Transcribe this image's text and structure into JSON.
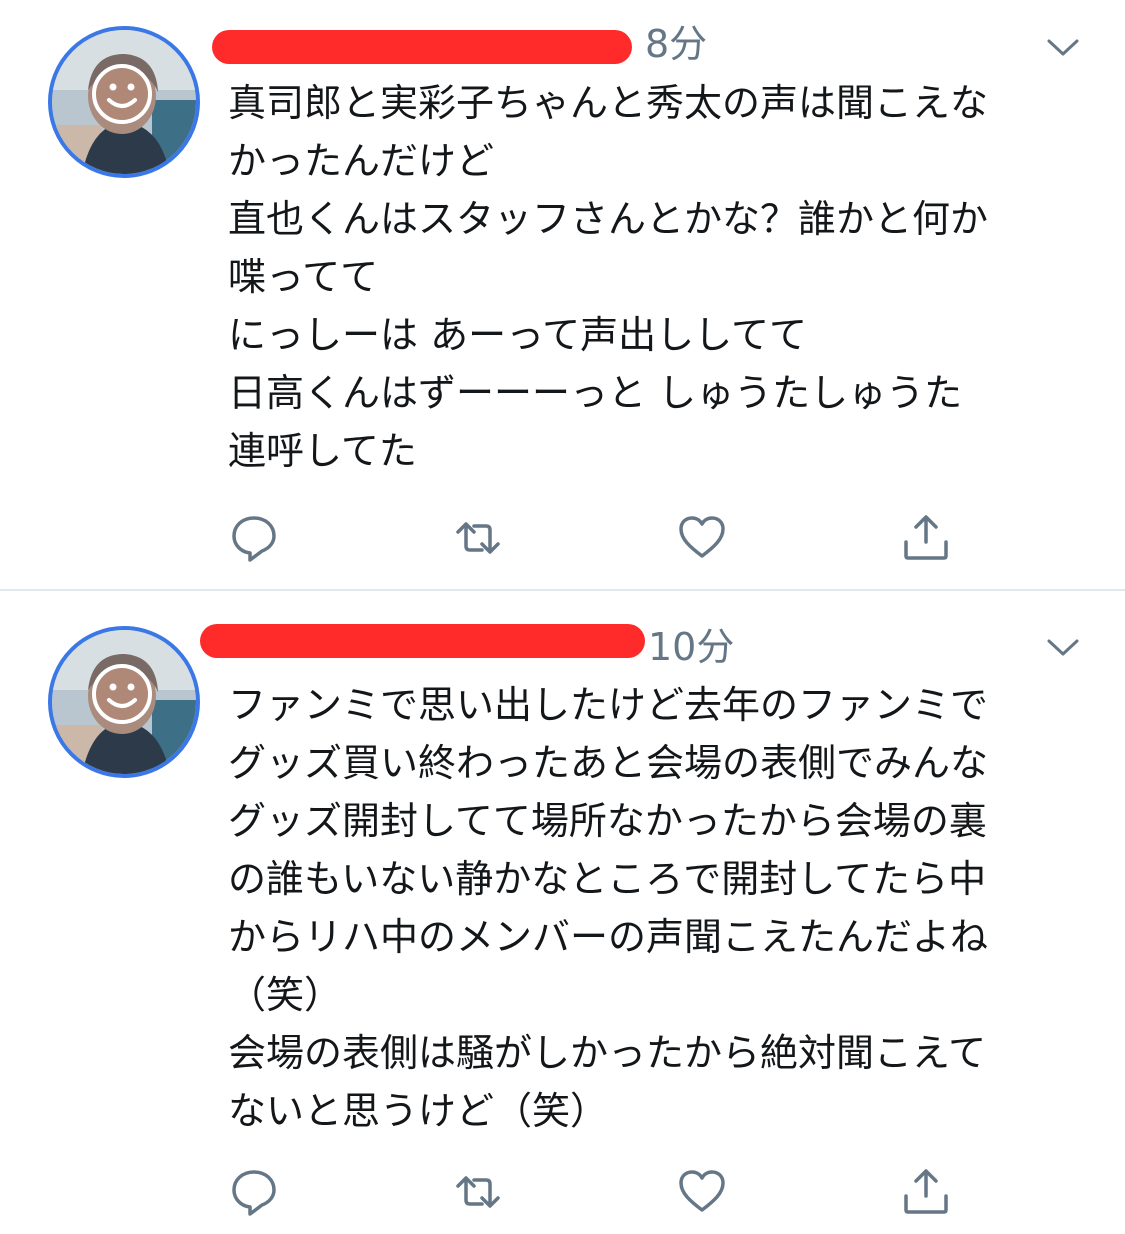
{
  "timeline": {
    "tweets": [
      {
        "time": "8分",
        "lines": [
          "真司郎と実彩子ちゃんと秀太の声は聞こえな",
          "かったんだけど",
          "直也くんはスタッフさんとかな？誰かと何か",
          "喋ってて",
          "にっしーは あーって声出ししてて",
          "日高くんはずーーーっと しゅうたしゅうた",
          "連呼してた"
        ],
        "actions": {
          "reply_icon": "reply-icon",
          "retweet_icon": "retweet-icon",
          "like_icon": "heart-icon",
          "share_icon": "share-icon"
        }
      },
      {
        "time": "10分",
        "lines": [
          "ファンミで思い出したけど去年のファンミで",
          "グッズ買い終わったあと会場の表側でみんな",
          "グッズ開封してて場所なかったから会場の裏",
          "の誰もいない静かなところで開封してたら中",
          "からリハ中のメンバーの声聞こえたんだよね",
          "（笑）",
          "会場の表側は騒がしかったから絶対聞こえて",
          "ないと思うけど（笑）"
        ],
        "actions": {
          "reply_icon": "reply-icon",
          "retweet_icon": "retweet-icon",
          "like_icon": "heart-icon",
          "share_icon": "share-icon"
        }
      }
    ]
  },
  "colors": {
    "text": "#14171a",
    "muted": "#657786",
    "icon": "#657786",
    "divider": "#e1e8ed",
    "avatar_ring": "#3b78e7",
    "redaction": "#ff2a2a"
  }
}
